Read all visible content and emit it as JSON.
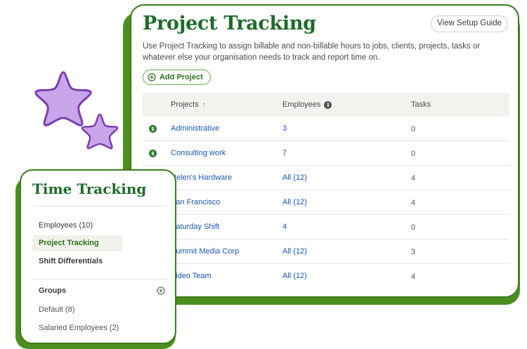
{
  "project_tracking": {
    "title": "Project Tracking",
    "setup_guide_label": "View Setup Guide",
    "description": "Use Project Tracking to assign billable and non-billable hours to jobs, clients, projects, tasks or whatever else your organisation needs to track and report time on.",
    "add_project_label": "Add Project",
    "columns": {
      "projects": "Projects",
      "employees": "Employees",
      "tasks": "Tasks"
    },
    "rows": [
      {
        "billable": true,
        "project": "Administrative",
        "employees": "3",
        "tasks": "0"
      },
      {
        "billable": true,
        "project": "Consulting work",
        "employees": "7",
        "tasks": "0"
      },
      {
        "billable": false,
        "project": "Helen's Hardware",
        "employees": "All (12)",
        "tasks": "4"
      },
      {
        "billable": false,
        "project": "San Francisco",
        "employees": "All (12)",
        "tasks": "4"
      },
      {
        "billable": false,
        "project": "Saturday Shift",
        "employees": "4",
        "tasks": "0"
      },
      {
        "billable": false,
        "project": "Summit Media Corp",
        "employees": "All (12)",
        "tasks": "3"
      },
      {
        "billable": false,
        "project": "Video Team",
        "employees": "All (12)",
        "tasks": "4"
      }
    ]
  },
  "time_tracking": {
    "title": "Time Tracking",
    "nav": [
      {
        "label": "Employees (10)",
        "active": false
      },
      {
        "label": "Project Tracking",
        "active": true
      },
      {
        "label": "Shift Differentials",
        "active": false
      }
    ],
    "groups_label": "Groups",
    "groups": [
      "Default (8)",
      "Salaried Employees (2)"
    ]
  },
  "colors": {
    "brand_green": "#1f6b2a",
    "card_shadow_green": "#4c8f1f",
    "link_blue": "#1b55b0",
    "star_purple": "#c9a5ea"
  }
}
